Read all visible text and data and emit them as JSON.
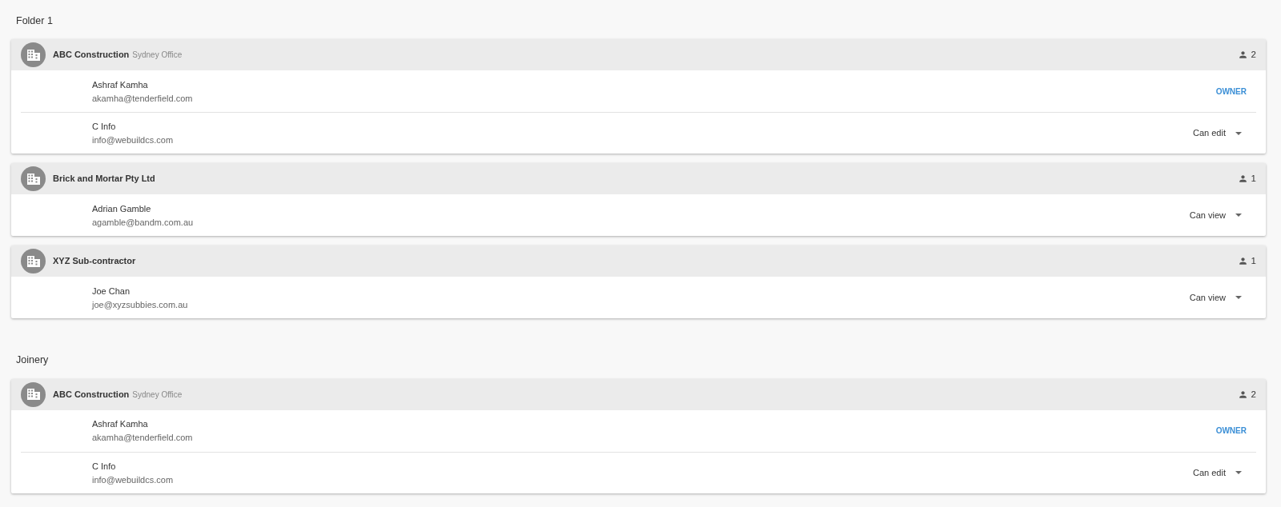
{
  "folders": [
    {
      "title": "Folder 1",
      "companies": [
        {
          "name": "ABC Construction",
          "office": "Sydney Office",
          "count": "2",
          "members": [
            {
              "name": "Ashraf Kamha",
              "email": "akamha@tenderfield.com",
              "kind": "owner",
              "role": "OWNER"
            },
            {
              "name": "C Info",
              "email": "info@webuildcs.com",
              "kind": "select",
              "role": "Can edit"
            }
          ]
        },
        {
          "name": "Brick and Mortar Pty Ltd",
          "count": "1",
          "members": [
            {
              "name": "Adrian Gamble",
              "email": "agamble@bandm.com.au",
              "kind": "select",
              "role": "Can view"
            }
          ]
        },
        {
          "name": "XYZ Sub-contractor",
          "count": "1",
          "members": [
            {
              "name": "Joe Chan",
              "email": "joe@xyzsubbies.com.au",
              "kind": "select",
              "role": "Can view"
            }
          ]
        }
      ]
    },
    {
      "title": "Joinery",
      "companies": [
        {
          "name": "ABC Construction",
          "office": "Sydney Office",
          "count": "2",
          "members": [
            {
              "name": "Ashraf Kamha",
              "email": "akamha@tenderfield.com",
              "kind": "owner",
              "role": "OWNER"
            },
            {
              "name": "C Info",
              "email": "info@webuildcs.com",
              "kind": "select",
              "role": "Can edit"
            }
          ]
        }
      ]
    }
  ]
}
